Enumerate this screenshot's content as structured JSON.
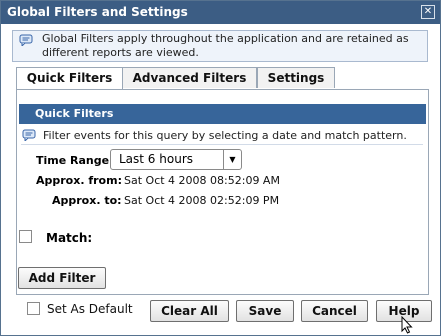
{
  "dialog": {
    "title": "Global Filters and Settings",
    "close_glyph": "✕"
  },
  "info": {
    "text": "Global Filters apply throughout the application and are retained as different reports are viewed."
  },
  "tabs": [
    {
      "label": "Quick Filters",
      "active": true
    },
    {
      "label": "Advanced Filters",
      "active": false
    },
    {
      "label": "Settings",
      "active": false
    }
  ],
  "panel": {
    "header": "Quick Filters",
    "hint": "Filter events for this query by selecting a date and match pattern.",
    "time_range_label": "Time Range:",
    "time_range_value": "Last 6 hours",
    "approx_from_label": "Approx. from:",
    "approx_from_value": "Sat Oct 4 2008 08:52:09 AM",
    "approx_to_label": "Approx. to:",
    "approx_to_value": "Sat Oct 4 2008 02:52:09 PM",
    "match_label": "Match:",
    "add_filter": "Add Filter"
  },
  "footer": {
    "set_default": "Set As Default",
    "clear_all": "Clear All",
    "save": "Save",
    "cancel": "Cancel",
    "help": "Help"
  },
  "colors": {
    "titlebar": "#3c5d84",
    "panel_header": "#37659a"
  },
  "icons": [
    "close-icon",
    "info-bubble-icon",
    "dropdown-arrow-icon",
    "mouse-cursor-icon"
  ]
}
